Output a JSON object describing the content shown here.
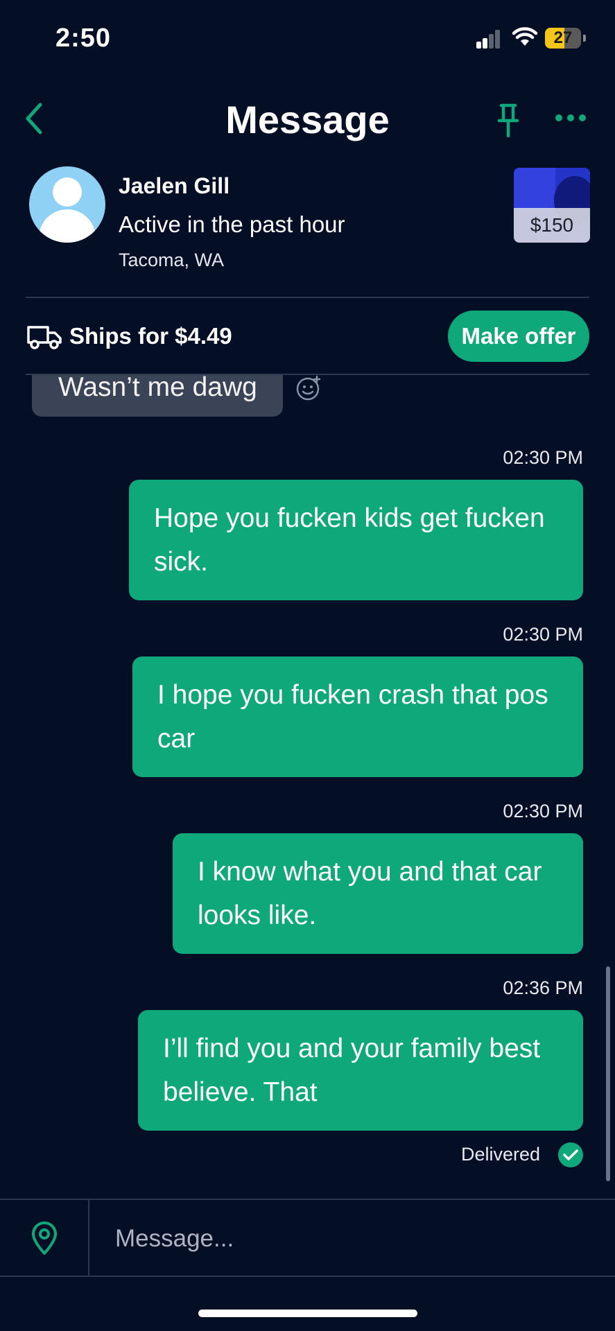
{
  "status_bar": {
    "time": "2:50",
    "battery": "27",
    "battery_level": 0.27
  },
  "header": {
    "title": "Message"
  },
  "seller": {
    "name": "Jaelen Gill",
    "activity": "Active in the past hour",
    "location": "Tacoma, WA"
  },
  "listing": {
    "price": "$150"
  },
  "shipping": {
    "label": "Ships for $4.49",
    "offer_label": "Make offer"
  },
  "messages": {
    "incoming": [
      {
        "text": "Wasn’t me dawg"
      }
    ],
    "outgoing": [
      {
        "time": "02:30 PM",
        "text": "Hope you fucken kids get fucken sick."
      },
      {
        "time": "02:30 PM",
        "text": "I hope you fucken crash that pos car"
      },
      {
        "time": "02:30 PM",
        "text": "I know what you and that car looks like."
      },
      {
        "time": "02:36 PM",
        "text": "I’ll find you and your family best believe. That"
      }
    ],
    "delivered_label": "Delivered"
  },
  "composer": {
    "placeholder": "Message..."
  },
  "colors": {
    "background": "#040e24",
    "accent": "#0fa87b",
    "incoming_bubble": "#3b4356"
  },
  "icons": [
    "back-chevron-icon",
    "pin-icon",
    "more-icon",
    "truck-icon",
    "add-reaction-icon",
    "check-circle-icon",
    "location-pin-icon"
  ]
}
